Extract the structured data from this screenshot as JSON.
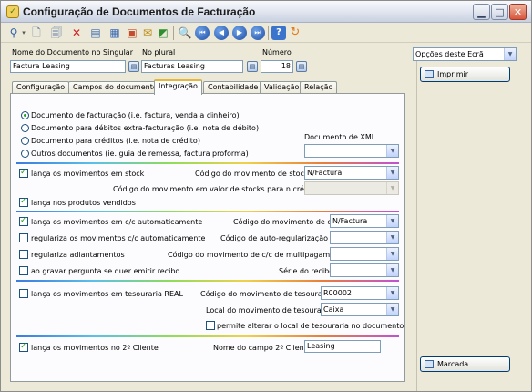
{
  "window": {
    "title": "Configuração de Documentos de Facturação",
    "icons": {
      "app": "yes-check-icon",
      "minimize": "minimize-icon",
      "maximize": "maximize-icon",
      "close": "close-icon"
    }
  },
  "toolbar": {
    "items": [
      "search-icon",
      "new-document-icon",
      "copy-document-icon",
      "delete-icon",
      "edit-form-icon",
      "list-icon",
      "tree-icon",
      "mail-icon",
      "chart-icon",
      "preview-icon",
      "first-record-icon",
      "previous-record-icon",
      "next-record-icon",
      "last-record-icon",
      "help-icon",
      "refresh-icon"
    ]
  },
  "header": {
    "singular_label": "Nome do Documento no Singular",
    "singular_value": "Factura Leasing",
    "plural_label": "No plural",
    "plural_value": "Facturas Leasing",
    "number_label": "Número",
    "number_value": "18"
  },
  "tabs": [
    {
      "label": "Configuração",
      "active": false
    },
    {
      "label": "Campos do documento",
      "active": false
    },
    {
      "label": "Integração",
      "active": true
    },
    {
      "label": "Contabilidade",
      "active": false
    },
    {
      "label": "Validação",
      "active": false
    },
    {
      "label": "Relação",
      "active": false
    }
  ],
  "integration": {
    "doc_type_options": [
      {
        "label": "Documento de facturação  (i.e. factura, venda a dinheiro)",
        "selected": true
      },
      {
        "label": "Documento para débitos extra-facturação (i.e. nota de débito)",
        "selected": false
      },
      {
        "label": "Documento para créditos (i.e. nota de crédito)",
        "selected": false
      },
      {
        "label": "Outros documentos (ie. guia de remessa, factura proforma)",
        "selected": false
      }
    ],
    "xml_label": "Documento de XML",
    "xml_value": "",
    "stocks": {
      "post_label": "lança os movimentos em stock",
      "post_checked": true,
      "code_label": "Código do movimento de stocks",
      "code_value": "N/Factura",
      "credit_code_label": "Código do movimento em valor de stocks para n.crédito",
      "credit_code_value": "",
      "sold_label": "lança nos produtos vendidos",
      "sold_checked": true
    },
    "accounts": {
      "auto_label": "lança os movimentos em c/c automaticamente",
      "auto_checked": true,
      "code_label": "Código do movimento de c/c",
      "code_value": "N/Factura",
      "reg_label": "regulariza os movimentos c/c automaticamente",
      "reg_checked": false,
      "reg_code_label": "Código de auto-regularização de c/c",
      "reg_code_value": "",
      "adv_label": "regulariza adiantamentos",
      "adv_checked": false,
      "multi_label": "Código do movimento de c/c de multipagamento",
      "multi_value": "",
      "receipt_label": "ao gravar pergunta se quer emitir recibo",
      "receipt_checked": false,
      "series_label": "Série do recibo",
      "series_value": ""
    },
    "treasury": {
      "real_label": "lança os movimentos em tesouraria REAL",
      "real_checked": false,
      "code_label": "Código do movimento de tesouraria",
      "code_value": "R00002",
      "local_label": "Local do movimento de tesouraria",
      "local_value": "Caixa",
      "allow_label": "permite alterar o local de tesouraria no documento",
      "allow_checked": false
    },
    "second_client": {
      "label": "lança os movimentos no 2º Cliente",
      "checked": true,
      "field_label": "Nome do campo 2º Cliente",
      "field_value": "Leasing"
    }
  },
  "right_pane": {
    "options_label": "Opções deste Ecrã",
    "print_label": "Imprimir",
    "mark_label": "Marcada"
  }
}
